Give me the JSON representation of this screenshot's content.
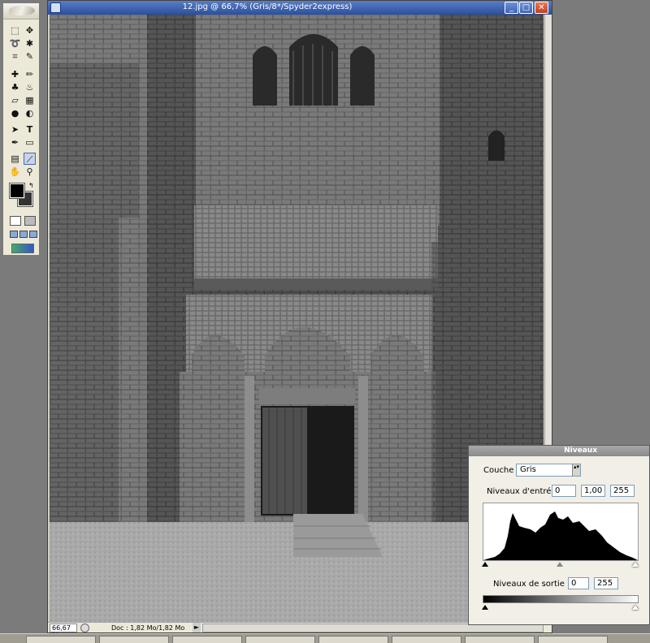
{
  "document": {
    "title": "12.jpg @ 66,7% (Gris/8*/Spyder2express)",
    "zoom": "66,67 %",
    "doc_size": "Doc : 1,82 Mo/1,82 Mo",
    "status_arrow": "►",
    "controls": {
      "minimize": "_",
      "maximize": "□",
      "close": "✕"
    },
    "image": "grayscale photo of a gothic stone church facade with arched wooden door"
  },
  "toolbox": {
    "tools": [
      "marquee-icon",
      "move-icon",
      "lasso-icon",
      "magic-wand-icon",
      "crop-icon",
      "slice-icon",
      "healing-icon",
      "brush-icon",
      "stamp-icon",
      "history-brush-icon",
      "eraser-icon",
      "gradient-icon",
      "blur-icon",
      "dodge-icon",
      "path-select-icon",
      "type-icon",
      "pen-icon",
      "shape-icon",
      "notes-icon",
      "eyedropper-icon",
      "hand-icon",
      "zoom-icon"
    ],
    "glyphs": {
      "marquee": "⬚",
      "move": "✥",
      "lasso": "➰",
      "wand": "✱",
      "crop": "⌗",
      "slice": "✎",
      "healing": "✚",
      "brush": "✏",
      "stamp": "♣",
      "history": "♨",
      "eraser": "▱",
      "gradient": "▦",
      "blur": "●",
      "dodge": "◐",
      "pathsel": "➤",
      "type": "T",
      "pen": "✒",
      "shape": "▭",
      "notes": "▤",
      "eyedropper": "⟋",
      "hand": "✋",
      "zoom": "⚲",
      "swap": "↰"
    },
    "foreground_color": "#000000",
    "background_color": "#333333"
  },
  "levels": {
    "title": "Niveaux",
    "channel_label": "Couche :",
    "channel_value": "Gris",
    "channel_arrow": "▴▾",
    "input_label": "Niveaux d'entrée :",
    "input_black": "0",
    "input_gamma": "1,00",
    "input_white": "255",
    "output_label": "Niveaux de sortie :",
    "output_black": "0",
    "output_white": "255"
  },
  "colors": {
    "title_bar": "#2a4f9e",
    "panel_bg": "#f1efe6",
    "workspace": "#7b7b7b"
  }
}
